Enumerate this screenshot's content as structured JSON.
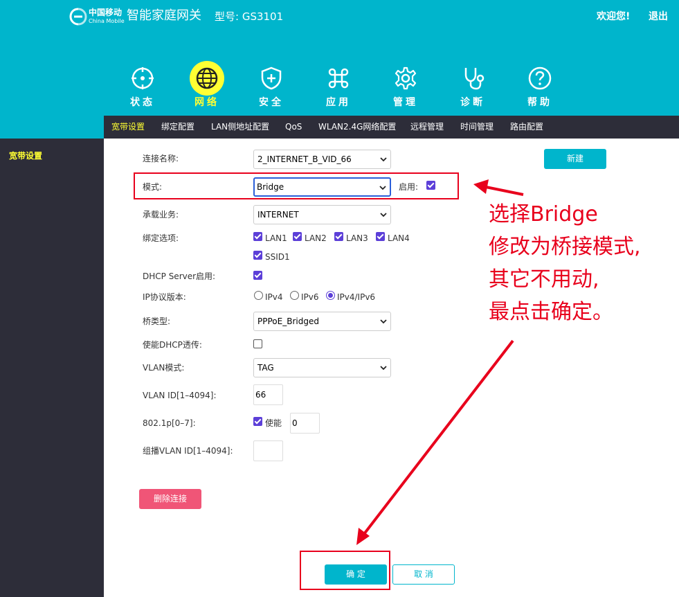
{
  "header": {
    "brand_cn": "中国移动",
    "brand_en": "China Mobile",
    "title": "智能家庭网关",
    "model": "型号: GS3101",
    "welcome": "欢迎您!",
    "logout": "退出",
    "background_color": "#00b5cc"
  },
  "nav": {
    "items": [
      {
        "label": "状态",
        "icon": "target-icon"
      },
      {
        "label": "网络",
        "icon": "globe-icon",
        "active": true
      },
      {
        "label": "安全",
        "icon": "shield-plus-icon"
      },
      {
        "label": "应用",
        "icon": "command-icon"
      },
      {
        "label": "管理",
        "icon": "gear-icon"
      },
      {
        "label": "诊断",
        "icon": "stethoscope-icon"
      },
      {
        "label": "帮助",
        "icon": "question-icon"
      }
    ],
    "active_color": "#ffff33"
  },
  "subnav": {
    "items": [
      "宽带设置",
      "绑定配置",
      "LAN侧地址配置",
      "QoS",
      "WLAN2.4G网络配置",
      "远程管理",
      "时间管理",
      "路由配置"
    ],
    "active_index": 0
  },
  "sidebar": {
    "items": [
      "宽带设置"
    ]
  },
  "form": {
    "connection_name_label": "连接名称:",
    "connection_name_value": "2_INTERNET_B_VID_66",
    "mode_label": "模式:",
    "mode_value": "Bridge",
    "enable_label": "启用:",
    "enable_checked": true,
    "service_label": "承载业务:",
    "service_value": "INTERNET",
    "binding_label": "绑定选项:",
    "binding_options": [
      {
        "label": "LAN1",
        "checked": true
      },
      {
        "label": "LAN2",
        "checked": true
      },
      {
        "label": "LAN3",
        "checked": true
      },
      {
        "label": "LAN4",
        "checked": true
      },
      {
        "label": "SSID1",
        "checked": true
      }
    ],
    "dhcp_server_label": "DHCP Server启用:",
    "dhcp_server_checked": true,
    "ip_version_label": "IP协议版本:",
    "ip_versions": [
      {
        "label": "IPv4",
        "checked": false
      },
      {
        "label": "IPv6",
        "checked": false
      },
      {
        "label": "IPv4/IPv6",
        "checked": true
      }
    ],
    "bridge_type_label": "桥类型:",
    "bridge_type_value": "PPPoE_Bridged",
    "dhcp_passthrough_label": "使能DHCP透传:",
    "dhcp_passthrough_checked": false,
    "vlan_mode_label": "VLAN模式:",
    "vlan_mode_value": "TAG",
    "vlan_id_label": "VLAN ID[1–4094]:",
    "vlan_id_value": "66",
    "priority_label": "802.1p[0–7]:",
    "priority_enable_label": "使能",
    "priority_enable_checked": true,
    "priority_value": "0",
    "multicast_vlan_label": "组播VLAN ID[1–4094]:",
    "multicast_vlan_value": ""
  },
  "buttons": {
    "new": "新建",
    "delete": "删除连接",
    "ok": "确 定",
    "cancel": "取 消"
  },
  "annotation": {
    "lines": [
      "选择Bridge",
      "修改为桥接模式,",
      "其它不用动,",
      "最点击确定。"
    ],
    "color": "#e8001c"
  }
}
